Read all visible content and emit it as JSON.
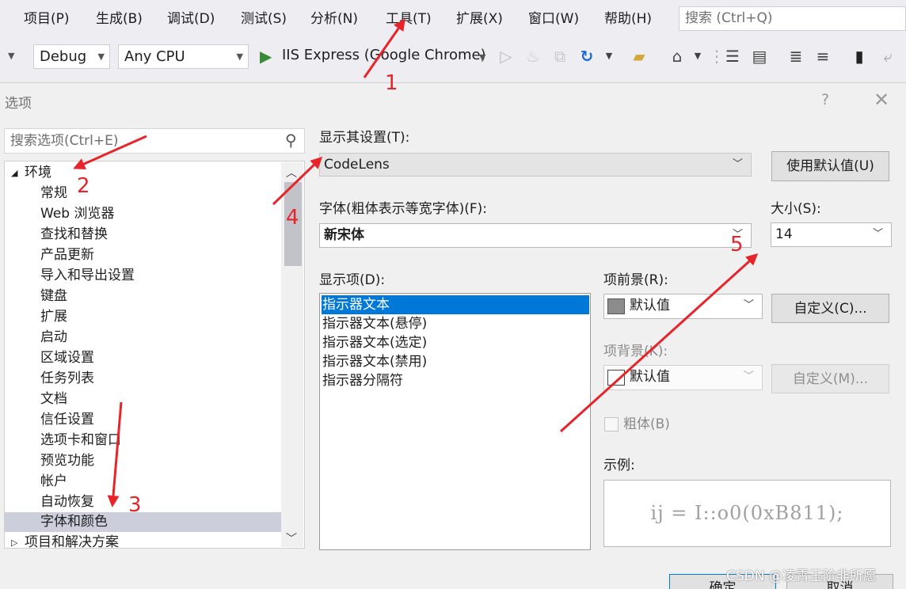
{
  "menu": {
    "items": [
      "项目(P)",
      "生成(B)",
      "调试(D)",
      "测试(S)",
      "分析(N)",
      "工具(T)",
      "扩展(X)",
      "窗口(W)",
      "帮助(H)"
    ],
    "search_placeholder": "搜索 (Ctrl+Q)"
  },
  "toolbar": {
    "config": "Debug",
    "platform": "Any CPU",
    "run_target": "IIS Express (Google Chrome)"
  },
  "dialog": {
    "title": "选项",
    "help": "?",
    "search_placeholder": "搜索选项(Ctrl+E)",
    "tree": [
      {
        "label": "环境",
        "expand": "◢"
      },
      {
        "label": "常规"
      },
      {
        "label": "Web 浏览器"
      },
      {
        "label": "查找和替换"
      },
      {
        "label": "产品更新"
      },
      {
        "label": "导入和导出设置"
      },
      {
        "label": "键盘"
      },
      {
        "label": "扩展"
      },
      {
        "label": "启动"
      },
      {
        "label": "区域设置"
      },
      {
        "label": "任务列表"
      },
      {
        "label": "文档"
      },
      {
        "label": "信任设置"
      },
      {
        "label": "选项卡和窗口"
      },
      {
        "label": "预览功能"
      },
      {
        "label": "帐户"
      },
      {
        "label": "自动恢复"
      },
      {
        "label": "字体和颜色",
        "selected": true
      },
      {
        "label": "项目和解决方案",
        "expand": "▷"
      }
    ],
    "show_settings_for_label": "显示其设置(T):",
    "show_settings_for_value": "CodeLens",
    "use_defaults_button": "使用默认值(U)",
    "font_label": "字体(粗体表示等宽字体)(F):",
    "font_value": "新宋体",
    "size_label": "大小(S):",
    "size_value": "14",
    "display_items_label": "显示项(D):",
    "display_items": [
      {
        "label": "指示器文本",
        "selected": true
      },
      {
        "label": "指示器文本(悬停)"
      },
      {
        "label": "指示器文本(选定)"
      },
      {
        "label": "指示器文本(禁用)"
      },
      {
        "label": "指示器分隔符"
      }
    ],
    "fg_label": "项前景(R):",
    "fg_value": "默认值",
    "fg_custom_button": "自定义(C)...",
    "bg_label": "项背景(K):",
    "bg_value": "默认值",
    "bg_custom_button": "自定义(M)...",
    "bold_label": "粗体(B)",
    "sample_label": "示例:",
    "sample_text": "ij = I::o0(0xB811);",
    "ok_button": "确定",
    "cancel_button": "取消"
  },
  "annotations": [
    "1",
    "2",
    "3",
    "4",
    "5"
  ],
  "annotation_color": "#e8242b",
  "watermark": "CSDN @凌霄玉阶非所愿"
}
